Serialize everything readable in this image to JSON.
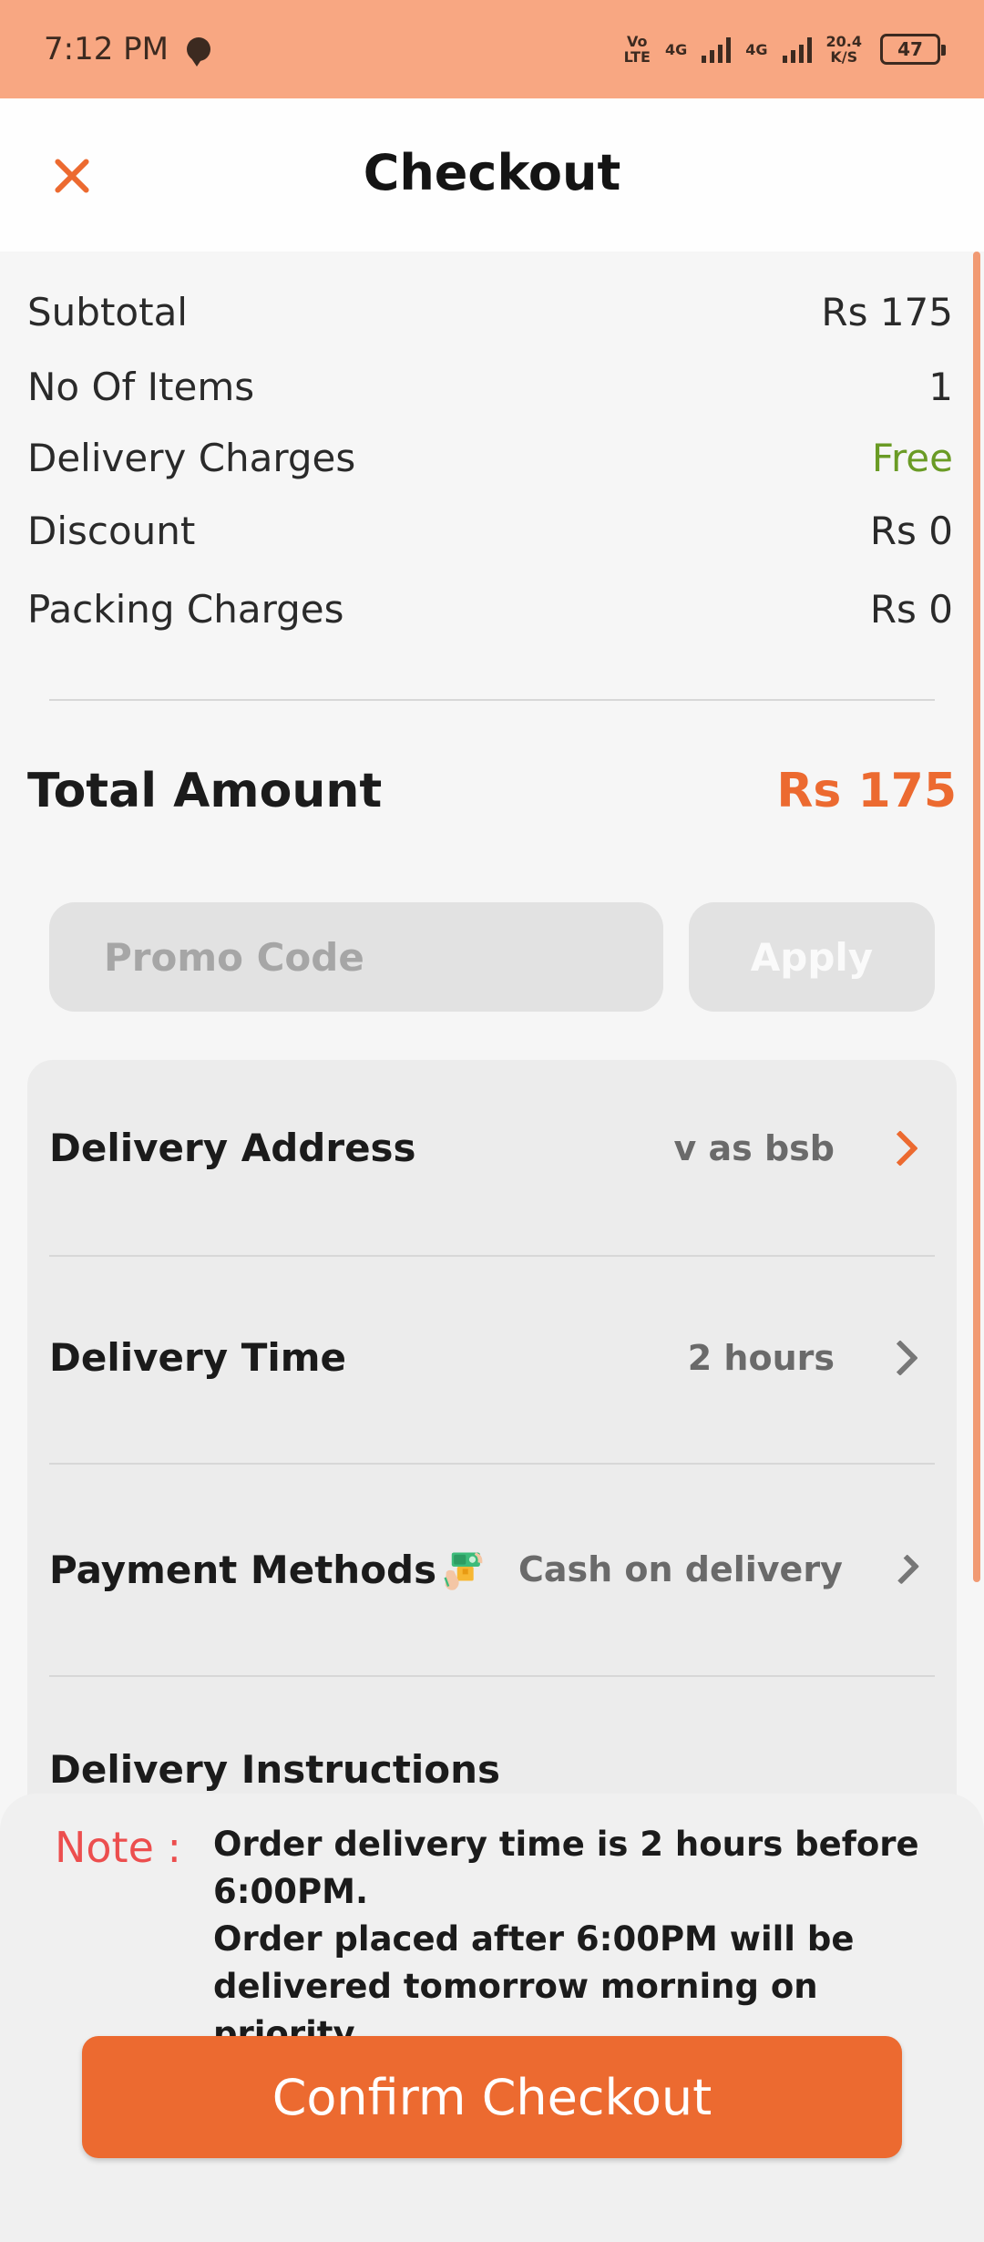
{
  "status_bar": {
    "time": "7:12 PM",
    "volte": "Vo\nLTE",
    "net1": "4G",
    "net2": "4G",
    "speed_value": "20.4",
    "speed_unit": "K/S",
    "battery": "47"
  },
  "header": {
    "title": "Checkout"
  },
  "summary": {
    "subtotal_label": "Subtotal",
    "subtotal_value": "Rs 175",
    "items_label": "No Of Items",
    "items_value": "1",
    "delivery_label": "Delivery Charges",
    "delivery_value": "Free",
    "discount_label": "Discount",
    "discount_value": "Rs 0",
    "packing_label": "Packing Charges",
    "packing_value": "Rs 0"
  },
  "total": {
    "label": "Total Amount",
    "value": "Rs 175"
  },
  "promo": {
    "placeholder": "Promo Code",
    "value": "",
    "apply_label": "Apply"
  },
  "options": {
    "address_label": "Delivery Address",
    "address_value": "v as bsb",
    "time_label": "Delivery Time",
    "time_value": "2 hours",
    "payment_label": "Payment Methods",
    "payment_value": "Cash on delivery",
    "instructions_label": "Delivery Instructions"
  },
  "note": {
    "label": "Note :",
    "line1": "Order delivery time is 2 hours before 6:00PM.",
    "line2": "Order placed after 6:00PM will be delivered tomorrow morning on priority."
  },
  "confirm": {
    "label": "Confirm Checkout"
  },
  "colors": {
    "accent": "#ec6a30",
    "status_bar": "#f8a782",
    "free": "#6a9b25",
    "note": "#ec4e4e"
  },
  "icons": {
    "close": "close-icon",
    "chevron": "chevron-right-icon",
    "payment": "cash-hand-icon"
  }
}
